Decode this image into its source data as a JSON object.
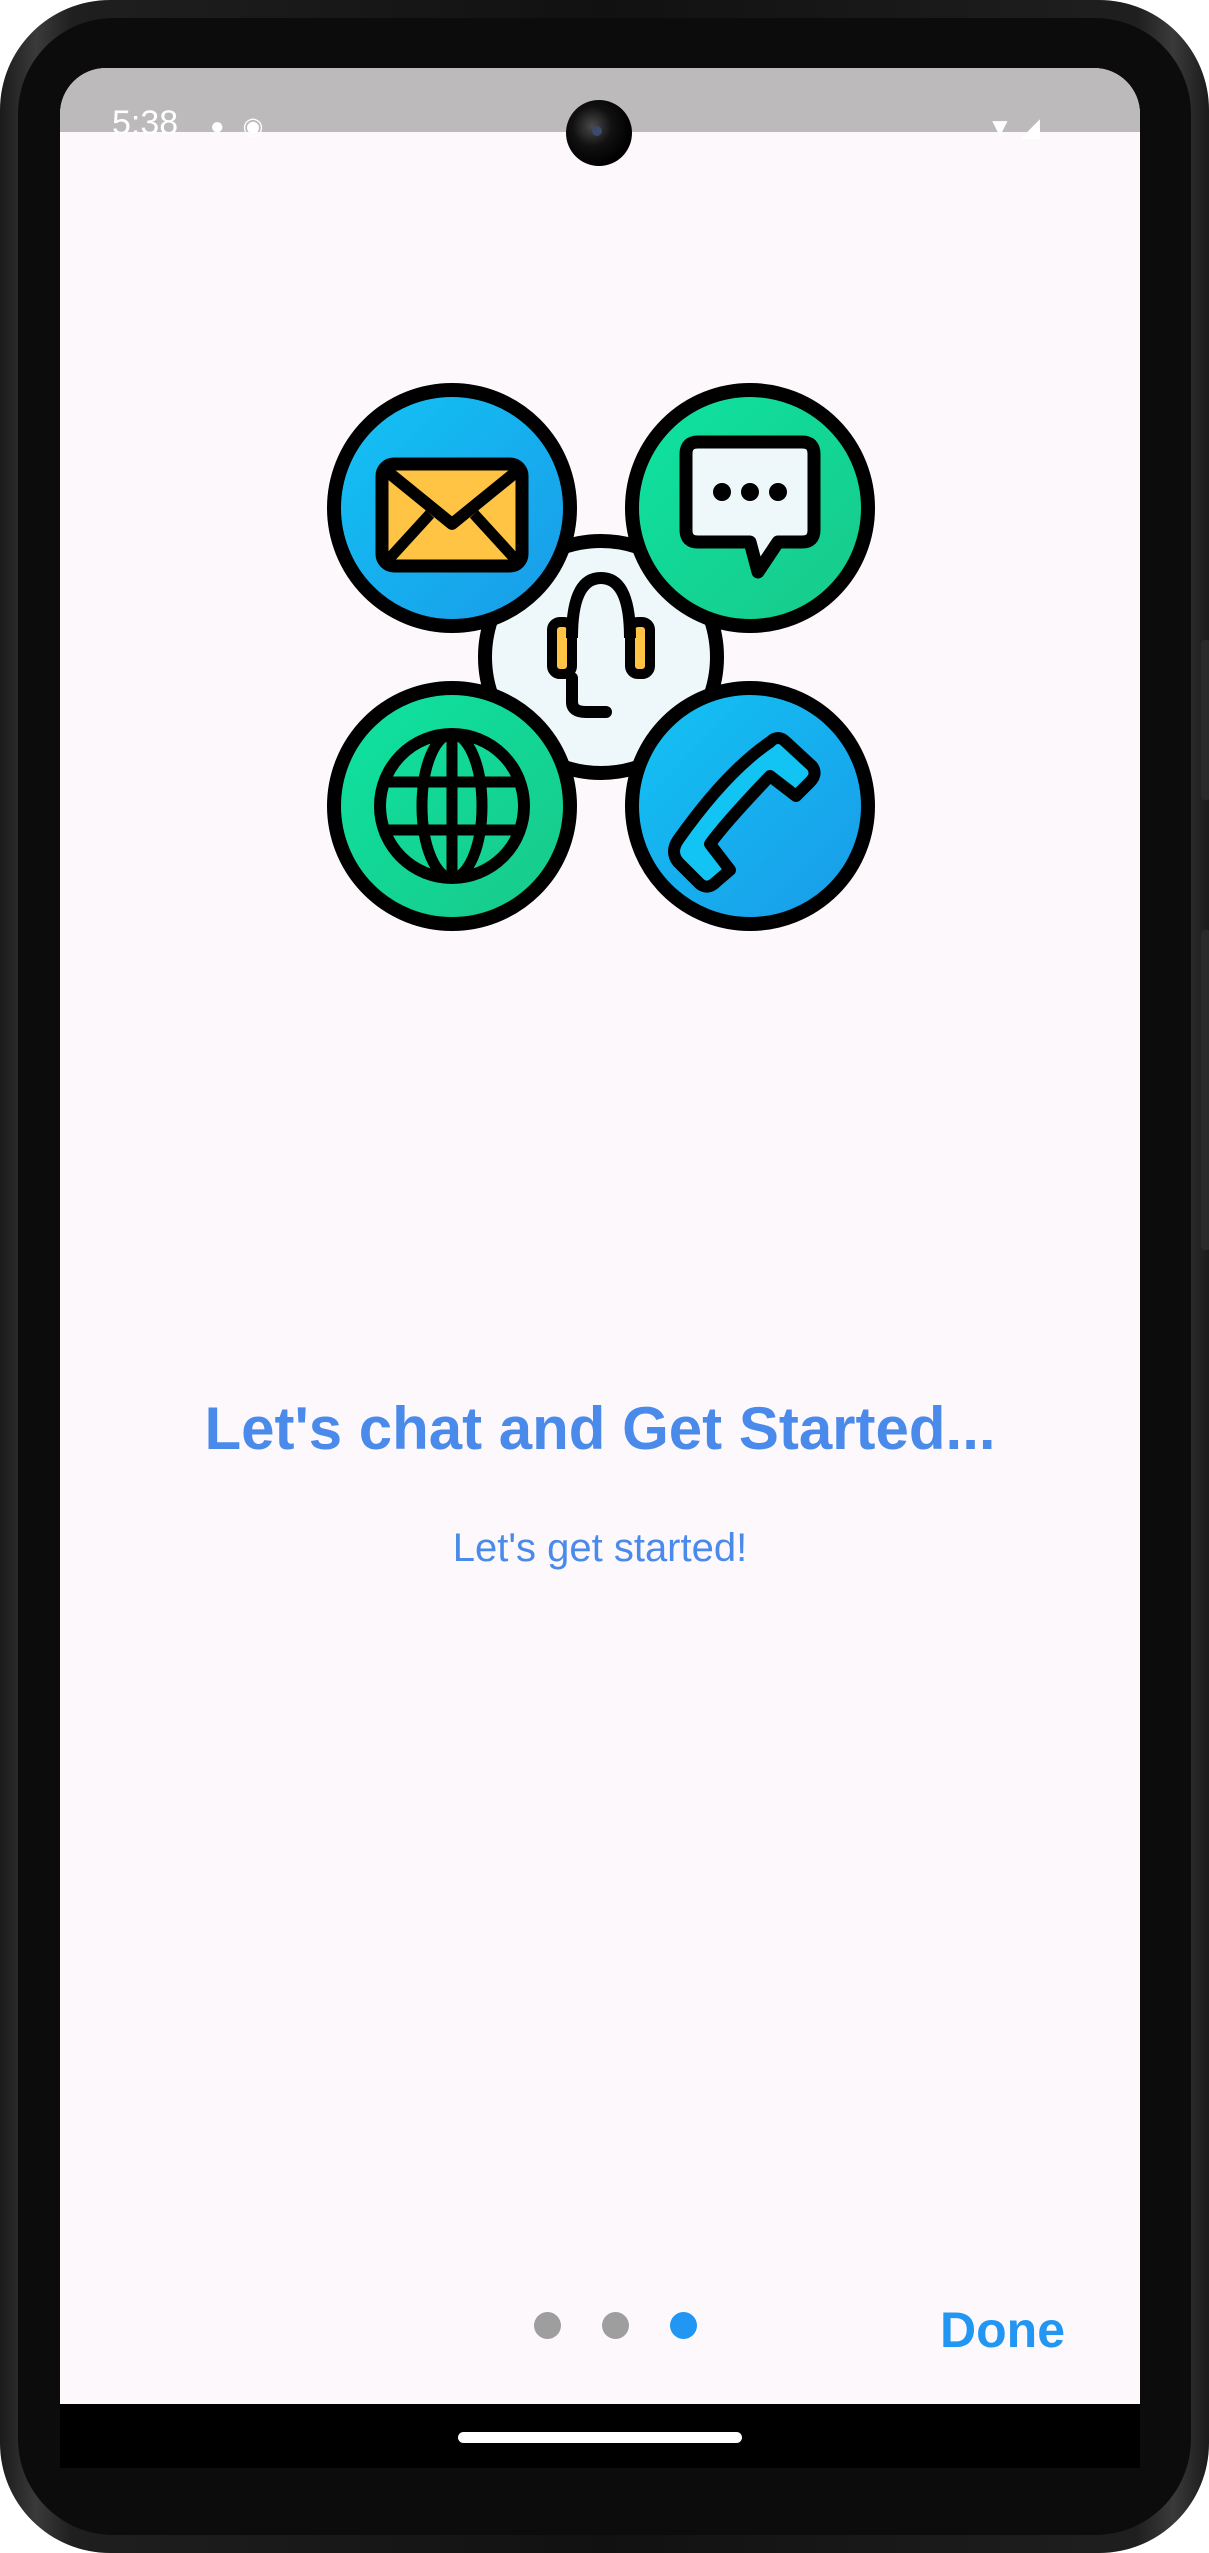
{
  "status_bar": {
    "time": "5:38",
    "left_icons": [
      "notification-icon",
      "notification-icon"
    ],
    "right_icons": [
      "wifi-icon",
      "signal-icon"
    ]
  },
  "onboarding": {
    "title": "Let's chat and Get Started...",
    "subtitle": "Let's get started!",
    "done_label": "Done",
    "page_indicator": {
      "total": 3,
      "active_index": 2
    },
    "hero_icons": [
      "mail-icon",
      "chat-bubble-icon",
      "headset-icon",
      "globe-icon",
      "phone-icon"
    ]
  },
  "colors": {
    "accent": "#4a8aea",
    "button": "#2196f3",
    "dot_inactive": "#9e9e9e",
    "background": "#fdf8fb"
  }
}
